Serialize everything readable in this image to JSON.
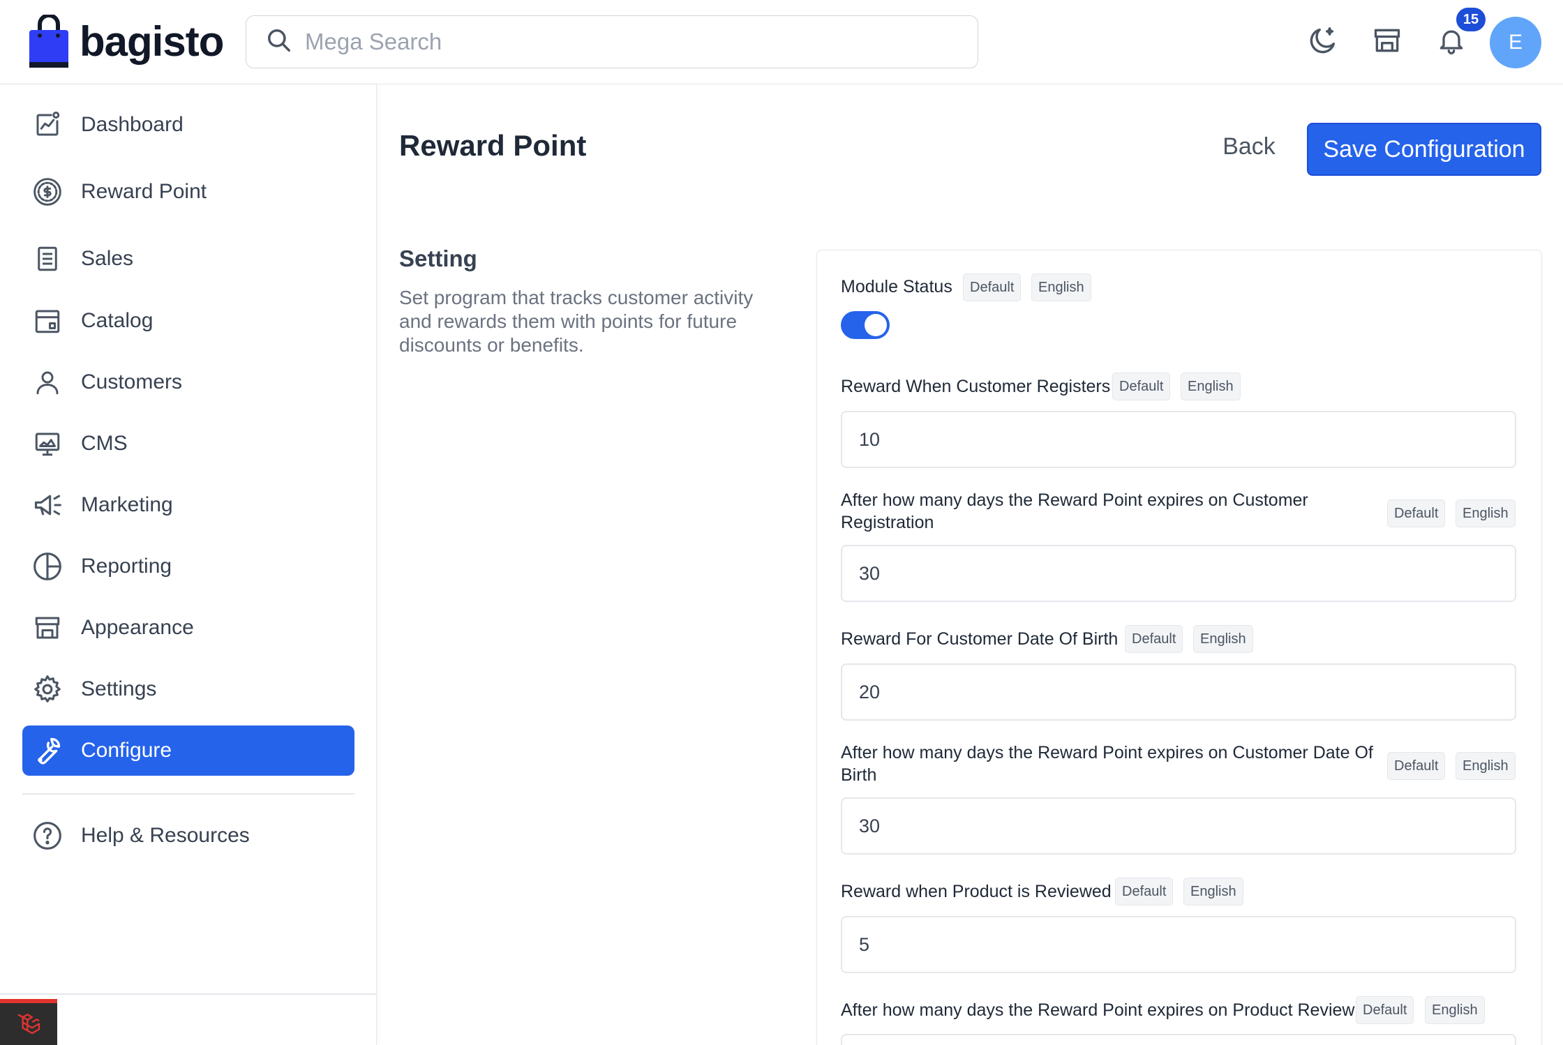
{
  "header": {
    "brand": "bagisto",
    "search_placeholder": "Mega Search",
    "notification_count": "15",
    "avatar_initial": "E"
  },
  "sidebar": {
    "items": [
      {
        "label": "Dashboard",
        "icon": "dashboard-icon"
      },
      {
        "label": "Reward Point",
        "icon": "dollar-circle-icon"
      },
      {
        "label": "Sales",
        "icon": "receipt-icon"
      },
      {
        "label": "Catalog",
        "icon": "catalog-icon"
      },
      {
        "label": "Customers",
        "icon": "user-icon"
      },
      {
        "label": "CMS",
        "icon": "monitor-icon"
      },
      {
        "label": "Marketing",
        "icon": "megaphone-icon"
      },
      {
        "label": "Reporting",
        "icon": "pie-chart-icon"
      },
      {
        "label": "Appearance",
        "icon": "store-icon"
      },
      {
        "label": "Settings",
        "icon": "gear-icon"
      },
      {
        "label": "Configure",
        "icon": "wrench-icon",
        "active": true
      }
    ],
    "help": {
      "label": "Help & Resources",
      "icon": "help-circle-icon"
    }
  },
  "page": {
    "title": "Reward Point",
    "back_label": "Back",
    "save_label": "Save Configuration"
  },
  "section": {
    "title": "Setting",
    "description": "Set program that tracks customer activity and rewards them with points for future discounts or benefits."
  },
  "tags": {
    "default": "Default",
    "locale": "English"
  },
  "fields": {
    "module_status": {
      "label": "Module Status",
      "enabled": true
    },
    "reward_register": {
      "label": "Reward When Customer Registers",
      "value": "10"
    },
    "expire_register": {
      "label": "After how many days the Reward Point expires on Customer Registration",
      "value": "30"
    },
    "reward_dob": {
      "label": "Reward For Customer Date Of Birth",
      "value": "20"
    },
    "expire_dob": {
      "label": "After how many days the Reward Point expires on Customer Date Of Birth",
      "value": "30"
    },
    "reward_review": {
      "label": "Reward when Product is Reviewed",
      "value": "5"
    },
    "expire_review": {
      "label": "After how many days the Reward Point expires on Product Review",
      "value": ""
    }
  },
  "colors": {
    "accent": "#2563eb",
    "avatar": "#60a5fa"
  }
}
